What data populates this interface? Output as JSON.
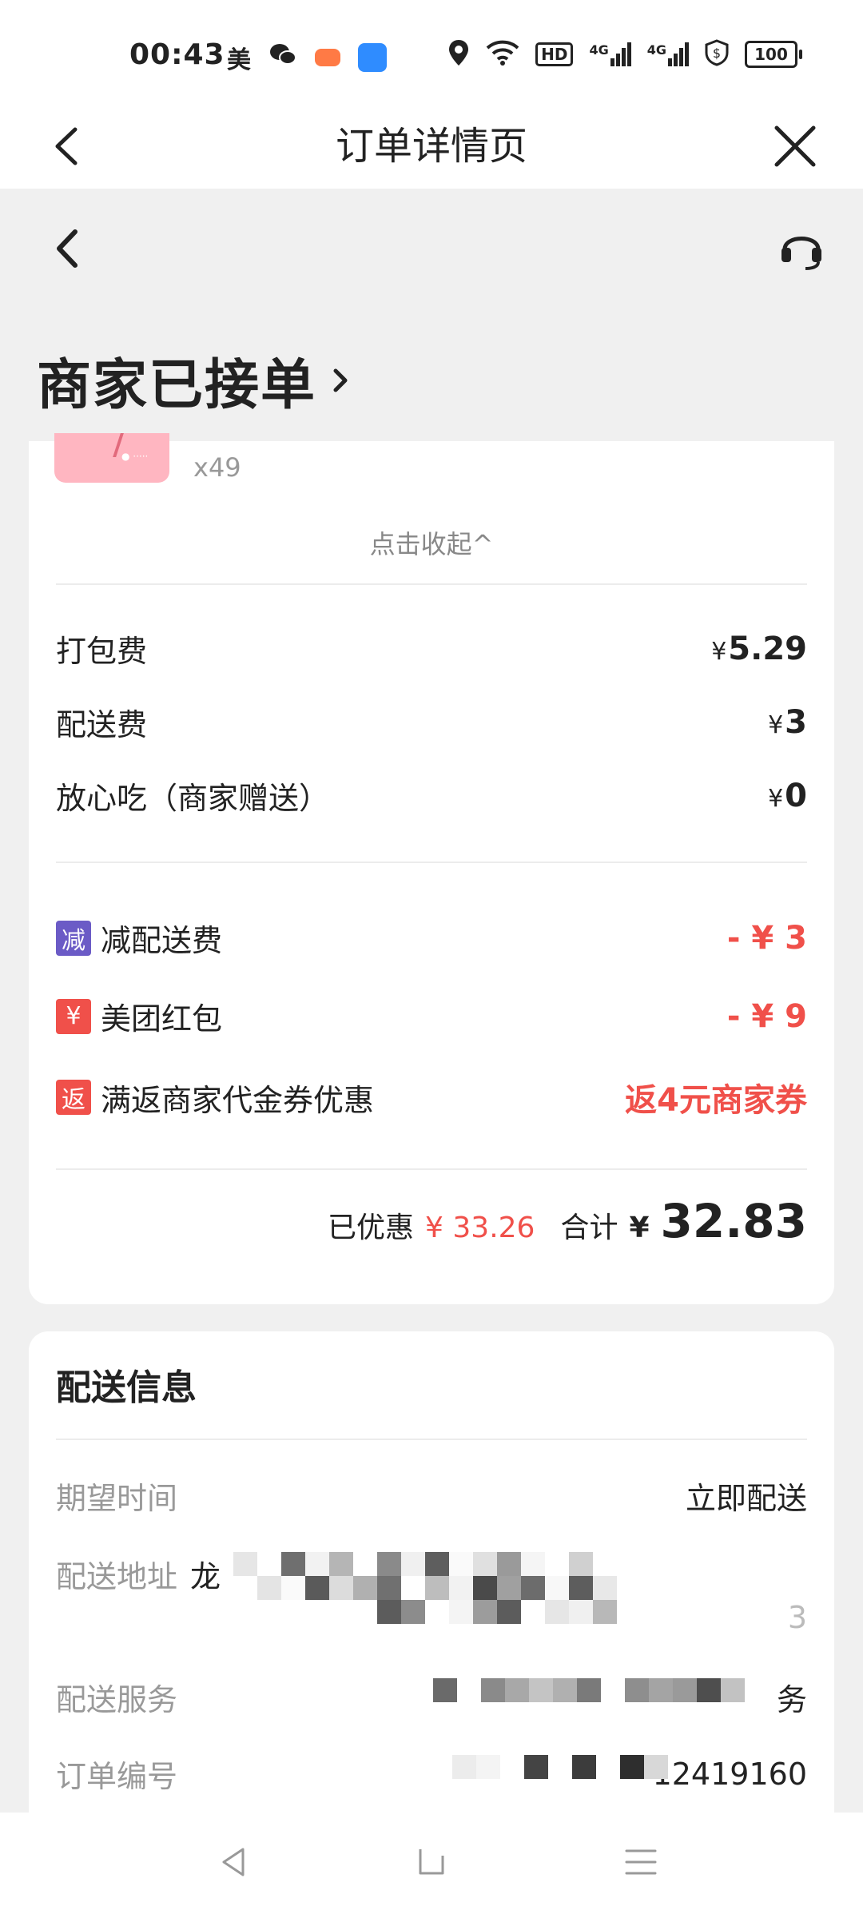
{
  "status_bar": {
    "time": "00:43",
    "app_icon_text": "美",
    "network_labels": [
      "HD",
      "4G",
      "4G"
    ],
    "battery": "100"
  },
  "title_bar": {
    "title": "订单详情页"
  },
  "order": {
    "status": "商家已接单"
  },
  "items": {
    "quantity": "x49",
    "collapse_label": "点击收起^"
  },
  "fees": [
    {
      "label": "打包费",
      "currency": "¥",
      "amount": "5.29"
    },
    {
      "label": "配送费",
      "currency": "¥",
      "amount": "3"
    },
    {
      "label": "放心吃（商家赠送）",
      "currency": "¥",
      "amount": "0"
    }
  ],
  "discounts": [
    {
      "badge": "减",
      "badge_color": "#6b5bc6",
      "label": "减配送费",
      "value": "- ¥ 3"
    },
    {
      "badge": "¥",
      "badge_color": "#f0504a",
      "label": "美团红包",
      "value": "- ¥ 9"
    },
    {
      "badge": "返",
      "badge_color": "#f0504a",
      "label": "满返商家代金券优惠",
      "value": "返4元商家券"
    }
  ],
  "totals": {
    "saved_label": "已优惠",
    "saved_value": "¥ 33.26",
    "total_label": "合计",
    "currency": "¥",
    "total_value": "32.83"
  },
  "delivery": {
    "section_title": "配送信息",
    "rows": [
      {
        "label": "期望时间",
        "value": "立即配送"
      },
      {
        "label": "配送地址",
        "value": "龙"
      },
      {
        "label": "配送服务",
        "value": "务"
      },
      {
        "label": "订单编号",
        "value": "12419160"
      }
    ]
  },
  "colors": {
    "accent_red": "#f0504a",
    "badge_purple": "#6b5bc6",
    "background": "#f0f0f0"
  }
}
